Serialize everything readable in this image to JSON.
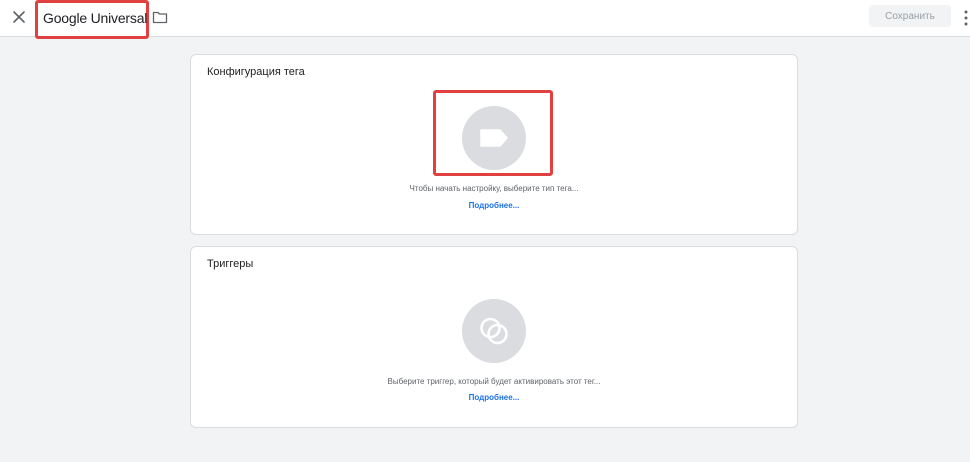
{
  "header": {
    "title": "Google Universal",
    "save_label": "Сохранить",
    "icons": {
      "close": "close-icon",
      "folder": "folder-icon",
      "more": "more-vert-icon"
    }
  },
  "tag_card": {
    "title": "Конфигурация тега",
    "hint": "Чтобы начать настройку, выберите тип тега...",
    "link": "Подробнее...",
    "icon": "tag-icon"
  },
  "trigger_card": {
    "title": "Триггеры",
    "hint": "Выберите триггер, который будет активировать этот тег...",
    "link": "Подробнее...",
    "icon": "trigger-icon"
  },
  "colors": {
    "highlight": "#e0403f",
    "link": "#1a73e8",
    "background": "#f1f3f4",
    "placeholder_circle": "#dadce0"
  }
}
